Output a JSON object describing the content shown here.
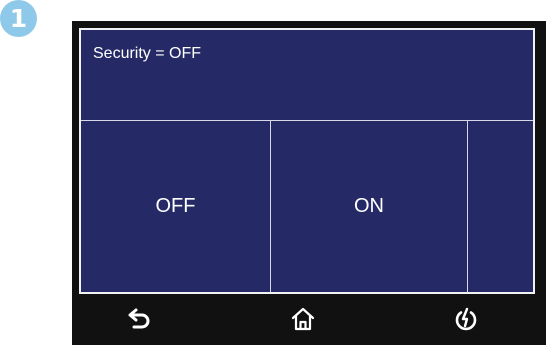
{
  "step": {
    "number": "1"
  },
  "colors": {
    "badge": "#8ec9e9",
    "panel": "#252a66",
    "bezel": "#111111",
    "text": "#ffffff"
  },
  "screen": {
    "status_text": "Security = OFF",
    "options": [
      {
        "label": "OFF"
      },
      {
        "label": "ON"
      },
      {
        "label": ""
      }
    ]
  },
  "nav": {
    "items": [
      {
        "icon": "back-arrow-icon"
      },
      {
        "icon": "home-icon"
      },
      {
        "icon": "power-icon"
      }
    ]
  }
}
